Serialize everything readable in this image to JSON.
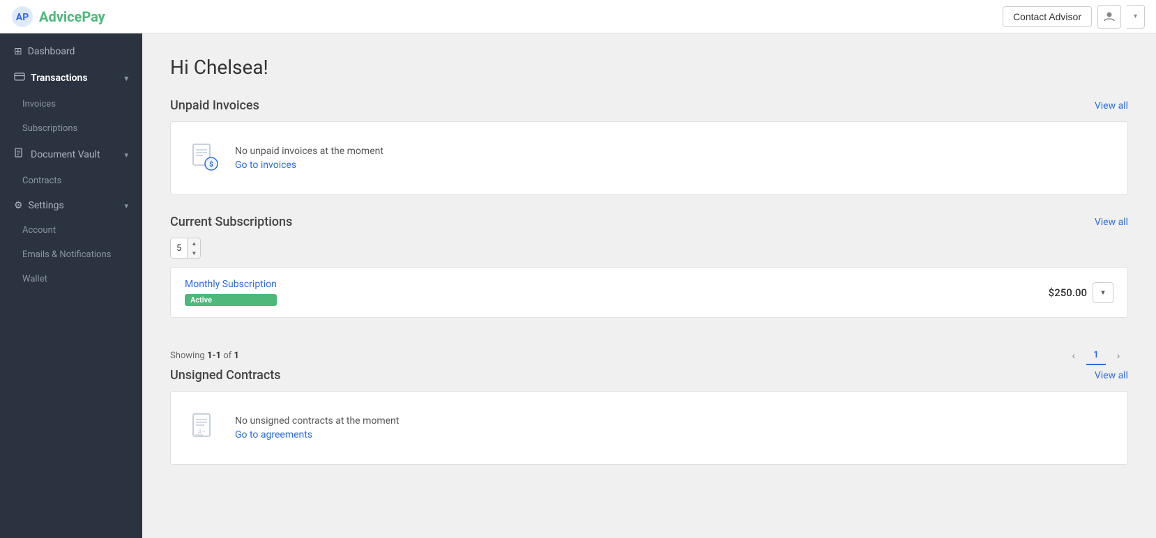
{
  "app": {
    "name": "AdvicePay",
    "logo_text_main": "Advice",
    "logo_text_accent": "Pay"
  },
  "topnav": {
    "contact_advisor_label": "Contact Advisor",
    "user_icon": "👤",
    "dropdown_icon": "▾"
  },
  "sidebar": {
    "items": [
      {
        "id": "dashboard",
        "label": "Dashboard",
        "icon": "⊞",
        "type": "item",
        "active": false
      },
      {
        "id": "transactions",
        "label": "Transactions",
        "icon": "💳",
        "type": "section",
        "expanded": true,
        "active": true
      },
      {
        "id": "invoices",
        "label": "Invoices",
        "type": "sub"
      },
      {
        "id": "subscriptions",
        "label": "Subscriptions",
        "type": "sub"
      },
      {
        "id": "document-vault",
        "label": "Document Vault",
        "icon": "📄",
        "type": "section",
        "expanded": true,
        "active": false
      },
      {
        "id": "contracts",
        "label": "Contracts",
        "type": "sub"
      },
      {
        "id": "settings",
        "label": "Settings",
        "icon": "⚙",
        "type": "section",
        "expanded": true,
        "active": false
      },
      {
        "id": "account",
        "label": "Account",
        "type": "sub"
      },
      {
        "id": "emails-notifications",
        "label": "Emails & Notifications",
        "type": "sub"
      },
      {
        "id": "wallet",
        "label": "Wallet",
        "type": "sub"
      }
    ]
  },
  "main": {
    "greeting": "Hi Chelsea!",
    "sections": {
      "unpaid_invoices": {
        "title": "Unpaid Invoices",
        "view_all": "View all",
        "empty_message": "No unpaid invoices at the moment",
        "empty_link": "Go to invoices"
      },
      "current_subscriptions": {
        "title": "Current Subscriptions",
        "view_all": "View all",
        "per_page": "5",
        "subscriptions": [
          {
            "name": "Monthly Subscription",
            "status": "Active",
            "amount": "$250.00"
          }
        ],
        "showing_text": "Showing ",
        "showing_range": "1-1",
        "showing_of": " of ",
        "showing_total": "1",
        "current_page": "1"
      },
      "unsigned_contracts": {
        "title": "Unsigned Contracts",
        "view_all": "View all",
        "empty_message": "No unsigned contracts at the moment",
        "empty_link": "Go to agreements"
      }
    }
  }
}
